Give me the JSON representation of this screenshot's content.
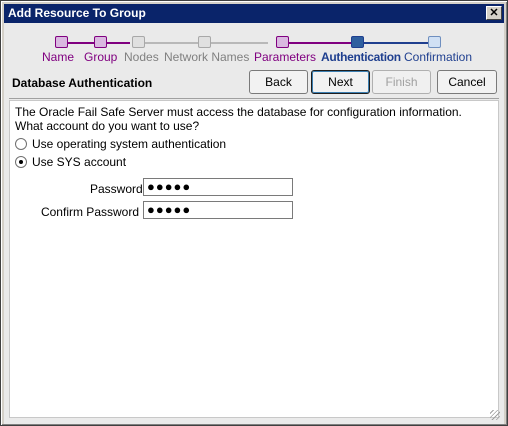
{
  "window": {
    "title": "Add Resource To Group",
    "close_glyph": "✕"
  },
  "train": {
    "steps": [
      {
        "label": "Name",
        "state": "visited"
      },
      {
        "label": "Group",
        "state": "visited"
      },
      {
        "label": "Nodes",
        "state": "disabled"
      },
      {
        "label": "Network Names",
        "state": "disabled"
      },
      {
        "label": "Parameters",
        "state": "visited"
      },
      {
        "label": "Authentication",
        "state": "current"
      },
      {
        "label": "Confirmation",
        "state": "next"
      }
    ]
  },
  "header": {
    "section_title": "Database Authentication",
    "back_label": "Back",
    "next_label": "Next",
    "finish_label": "Finish",
    "cancel_label": "Cancel"
  },
  "form": {
    "prompt": "The Oracle Fail Safe Server must access the database for configuration information.  What account do you want to use?",
    "option_os": "Use operating system authentication",
    "option_sys": "Use SYS account",
    "selected_option": "sys",
    "password_label": "Password",
    "password_value": "●●●●●",
    "confirm_label": "Confirm Password",
    "confirm_value": "●●●●●"
  },
  "colors": {
    "visited": "#800080",
    "current": "#1f3f8f",
    "disabled": "#808080",
    "next": "#1f3f8f",
    "titlebar": "#0a246a"
  }
}
